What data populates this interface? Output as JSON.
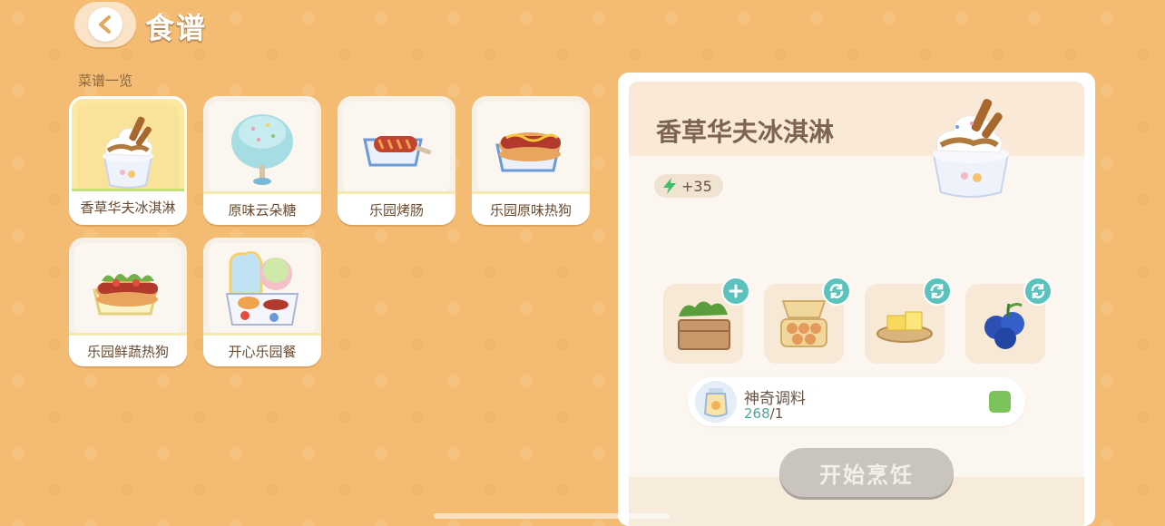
{
  "header": {
    "title": "食谱"
  },
  "recipe_list": {
    "label": "菜谱一览",
    "items": [
      {
        "name": "香草华夫冰淇淋",
        "icon": "waffle-ice-cream-icon",
        "selected": true
      },
      {
        "name": "原味云朵糖",
        "icon": "cotton-candy-icon",
        "selected": false
      },
      {
        "name": "乐园烤肠",
        "icon": "grilled-sausage-icon",
        "selected": false
      },
      {
        "name": "乐园原味热狗",
        "icon": "hot-dog-icon",
        "selected": false
      },
      {
        "name": "乐园鲜蔬热狗",
        "icon": "veggie-hot-dog-icon",
        "selected": false
      },
      {
        "name": "开心乐园餐",
        "icon": "happy-meal-icon",
        "selected": false
      }
    ]
  },
  "detail": {
    "title": "香草华夫冰淇淋",
    "image_icon": "waffle-ice-cream-icon",
    "energy": "+35",
    "ingredients": [
      {
        "icon": "lettuce-crate-icon",
        "action": "add"
      },
      {
        "icon": "egg-carton-icon",
        "action": "swap"
      },
      {
        "icon": "butter-icon",
        "action": "swap"
      },
      {
        "icon": "blueberry-icon",
        "action": "swap"
      }
    ],
    "seasoning": {
      "name": "神奇调料",
      "owned": "268",
      "required": "/1",
      "checked": true
    },
    "start_button": "开始烹饪"
  },
  "colors": {
    "background": "#f3bc72",
    "selected_card": "#fde8a0",
    "action_teal": "#5cc2bd",
    "check_green": "#7dc35c",
    "disabled_button": "#c9c4bd"
  }
}
